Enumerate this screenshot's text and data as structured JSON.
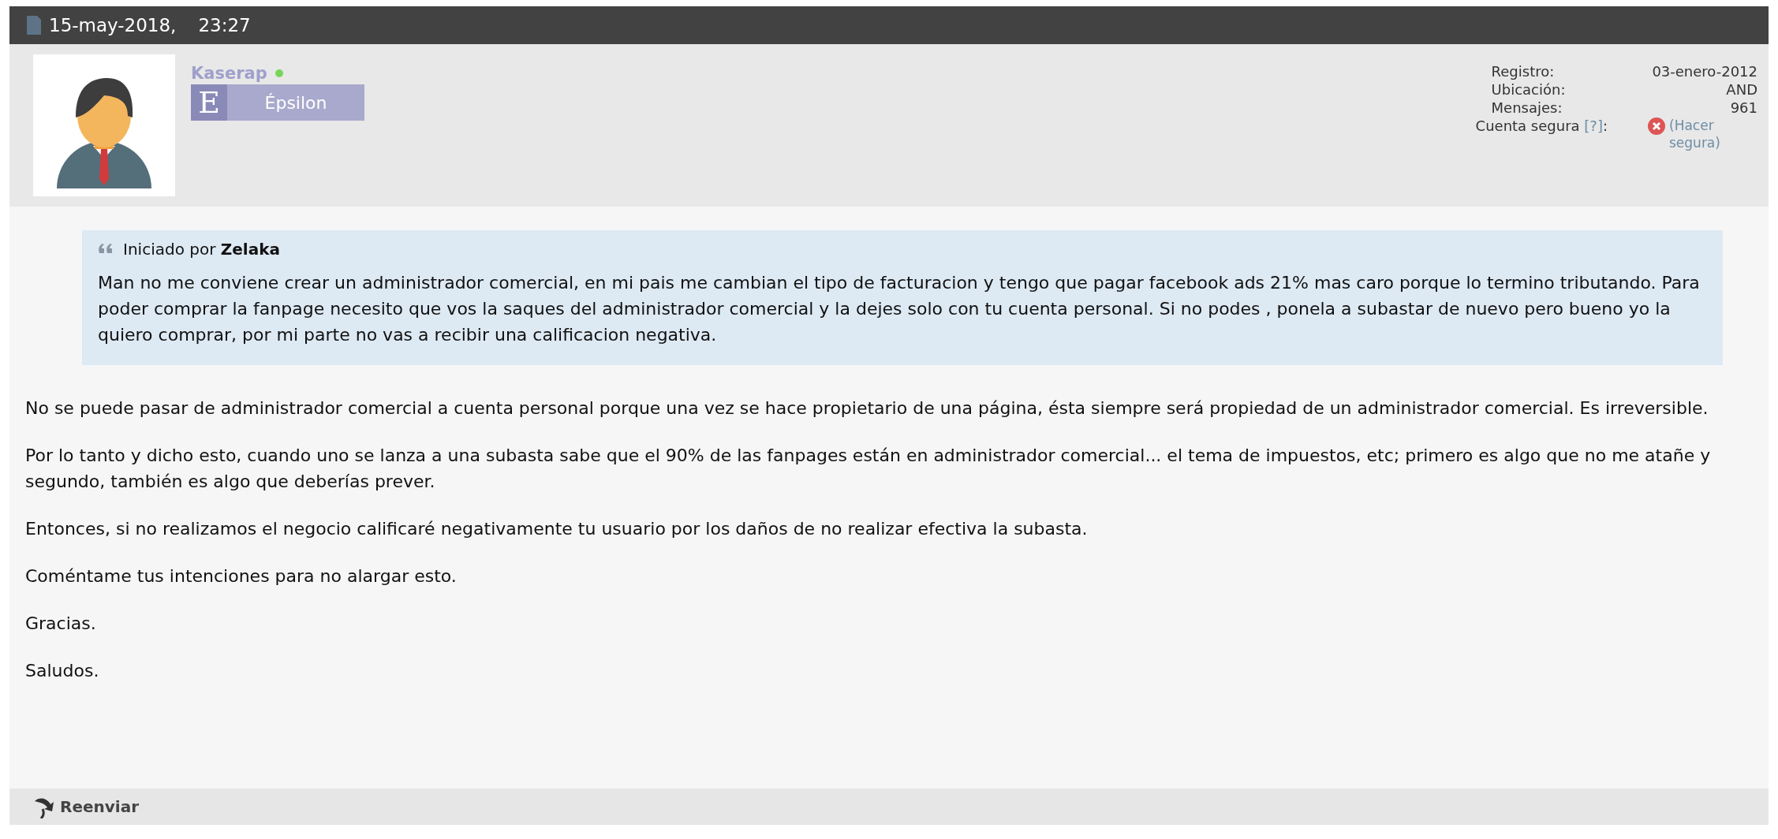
{
  "post_header": {
    "date": "15-may-2018,",
    "time": "23:27"
  },
  "user": {
    "name": "Kaserap",
    "online": true,
    "rank_letter": "E",
    "rank": "Épsilon",
    "stats": [
      {
        "label": "Registro:",
        "value": "03-enero-2012"
      },
      {
        "label": "Ubicación:",
        "value": "AND"
      },
      {
        "label": "Mensajes:",
        "value": "961"
      }
    ],
    "secure_account": {
      "label": "Cuenta segura",
      "help": "[?]",
      "colon": ":",
      "secure": false,
      "action": "(Hacer segura)"
    }
  },
  "quote": {
    "intro": "Iniciado por **Zelaka**",
    "text": "Man no me conviene crear un administrador comercial, en mi pais me cambian el tipo de facturacion y tengo que pagar facebook ads 21% mas caro porque lo termino tributando. Para poder comprar la fanpage necesito que vos la saques del administrador comercial y la dejes solo con tu cuenta personal. Si no podes , ponela a subastar de nuevo pero bueno yo la quiero comprar, por mi parte no vas a recibir una calificacion negativa."
  },
  "paragraphs": [
    "No se puede pasar de administrador comercial a cuenta personal porque una vez se hace propietario de una página, ésta siempre será propiedad de un administrador comercial. Es irreversible.",
    "Por lo tanto y dicho esto, cuando uno se lanza a una subasta sabe que el 90% de las fanpages están en administrador comercial... el tema de impuestos, etc; primero es algo que no me atañe y segundo, también es algo que deberías prever.",
    "Entonces, si no realizamos el negocio calificaré negativamente tu usuario por los daños de no realizar efectiva la subasta.",
    "Coméntame tus intenciones para no alargar esto.",
    "Gracias.",
    "Saludos."
  ],
  "footer": {
    "forward": "Reenviar"
  }
}
